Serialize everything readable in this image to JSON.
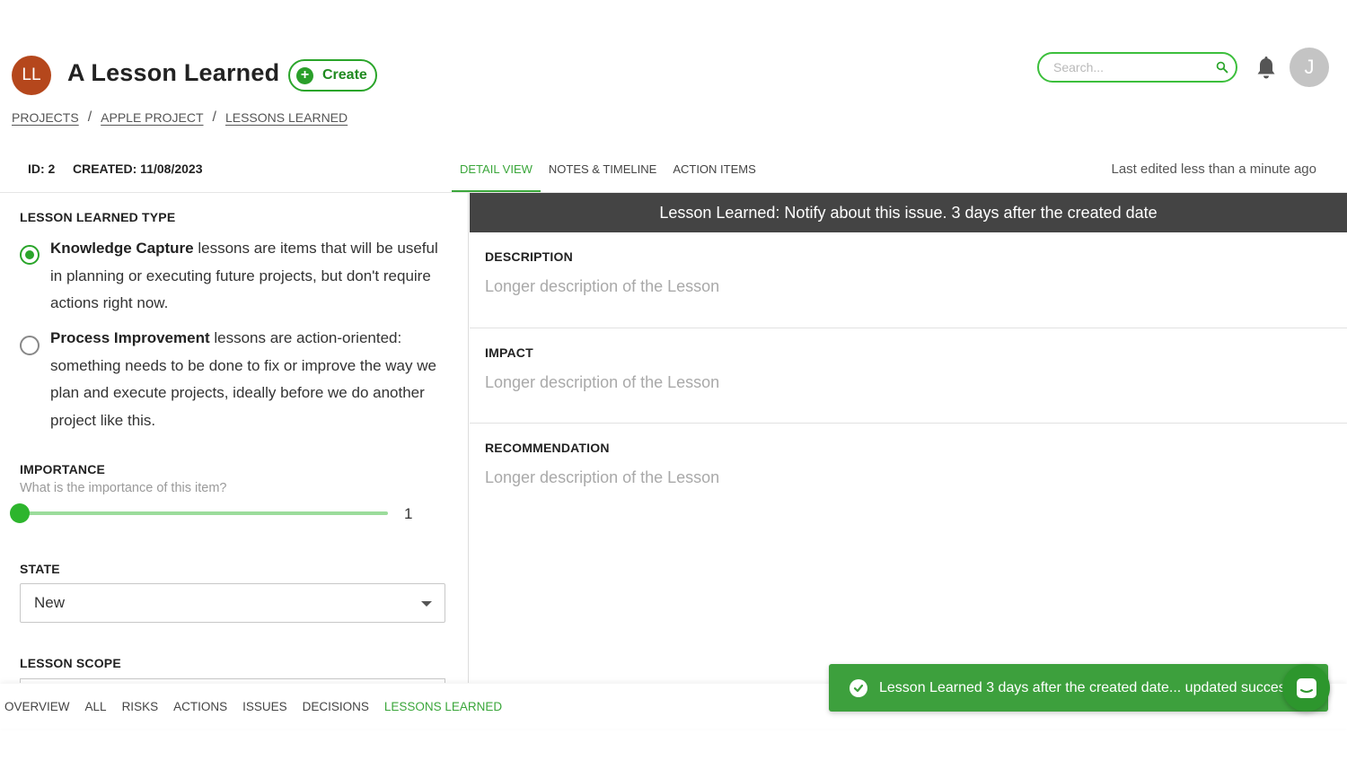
{
  "header": {
    "avatar_initials": "LL",
    "title": "A Lesson Learned",
    "create_label": "Create",
    "search_placeholder": "Search...",
    "user_initial": "J"
  },
  "breadcrumb": [
    "PROJECTS",
    "APPLE PROJECT",
    "LESSONS LEARNED"
  ],
  "meta": {
    "id": "ID: 2",
    "created": "CREATED: 11/08/2023",
    "last_edited": "Last edited less than a minute ago"
  },
  "tabs": [
    {
      "label": "DETAIL VIEW",
      "active": true
    },
    {
      "label": "NOTES & TIMELINE",
      "active": false
    },
    {
      "label": "ACTION ITEMS",
      "active": false
    }
  ],
  "lesson_type": {
    "heading": "LESSON LEARNED TYPE",
    "options": [
      {
        "title": "Knowledge Capture",
        "text": " lessons are items that will be useful in planning or executing future projects, but don't require actions right now.",
        "selected": true
      },
      {
        "title": "Process Improvement",
        "text": " lessons are action-oriented: something needs to be done to fix or improve the way we plan and execute projects, ideally before we do another project like this.",
        "selected": false
      }
    ]
  },
  "importance": {
    "heading": "IMPORTANCE",
    "help": "What is the importance of this item?",
    "value": "1"
  },
  "state": {
    "heading": "STATE",
    "value": "New"
  },
  "lesson_scope": {
    "heading": "LESSON SCOPE"
  },
  "banner": "Lesson Learned: Notify about this issue. 3 days after the created date",
  "fields": [
    {
      "label": "DESCRIPTION",
      "value": "Longer description of the Lesson"
    },
    {
      "label": "IMPACT",
      "value": "Longer description of the Lesson"
    },
    {
      "label": "RECOMMENDATION",
      "value": "Longer description of the Lesson"
    }
  ],
  "bottom_nav": [
    {
      "label": "OVERVIEW",
      "active": false
    },
    {
      "label": "ALL",
      "active": false
    },
    {
      "label": "RISKS",
      "active": false
    },
    {
      "label": "ACTIONS",
      "active": false
    },
    {
      "label": "ISSUES",
      "active": false
    },
    {
      "label": "DECISIONS",
      "active": false
    },
    {
      "label": "LESSONS LEARNED",
      "active": true
    }
  ],
  "toast": {
    "message": "Lesson Learned 3 days after the created date... updated successfully"
  },
  "colors": {
    "accent_green": "#3aa63a",
    "avatar_brown": "#b5471c",
    "banner_dark": "#444444"
  }
}
